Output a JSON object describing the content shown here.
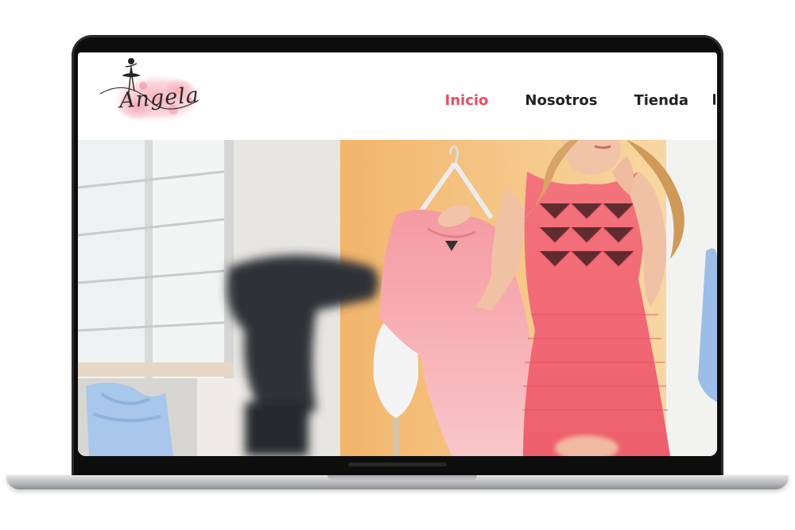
{
  "site": {
    "logo_text": "Angela"
  },
  "nav": {
    "items": [
      {
        "label": "Inicio",
        "active": true
      },
      {
        "label": "Nosotros",
        "active": false
      },
      {
        "label": "Tienda",
        "active": false
      }
    ]
  },
  "colors": {
    "accent": "#ee4a66",
    "nav_text": "#222222",
    "dress": "#f06b73",
    "background_wall": "#f5b46a"
  },
  "icons": {
    "logo": "ballerina-logo-icon",
    "menu_overflow": "more-icon"
  }
}
